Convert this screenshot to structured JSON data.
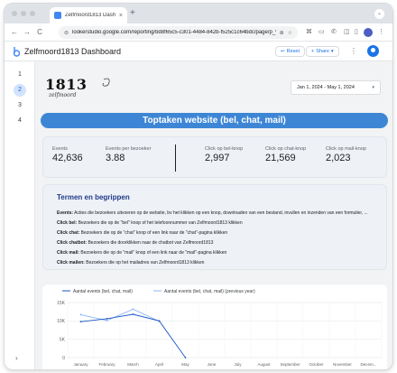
{
  "browser": {
    "tab_title": "Zelfmoord1813 Dashboard - ...",
    "tab_close": "×",
    "new_tab": "+",
    "tabs_menu": "⌄",
    "url": "lookerstudio.google.com/reporting/bd8f65c5-c301-4484-842b-f525c1c64bdc/page/p_%icjz...",
    "nav": {
      "back": "←",
      "forward": "→",
      "reload": "C"
    }
  },
  "app": {
    "title": "Zelfmoord1813 Dashboard",
    "reset_label": "Reset",
    "share_label": "Share",
    "reset_icon": "↩",
    "share_icon": "+",
    "share_caret": "▾",
    "more": "⋮"
  },
  "pages": [
    "1",
    "2",
    "3",
    "4"
  ],
  "active_page": "2",
  "collapse_icon": "›",
  "brand": {
    "number": "1813",
    "tagline": "zelfmoord"
  },
  "date_range": {
    "value": "Jan 1, 2024 - May 1, 2024",
    "caret": "▾"
  },
  "banner": "Toptaken website (bel, chat, mail)",
  "kpis": [
    {
      "label": "Events",
      "value": "42,636"
    },
    {
      "label": "Events per bezoeker",
      "value": "3.88"
    },
    {
      "label": "Click op bel-knop",
      "value": "2,997"
    },
    {
      "label": "Click op chat-knop",
      "value": "21,569"
    },
    {
      "label": "Click op mail-knop",
      "value": "2,023"
    }
  ],
  "terms": {
    "title": "Termen en begrippen",
    "items": [
      {
        "term": "Events:",
        "text": " Acties die bezoekers uitvoeren op de website, bv het klikken op een knop, downloaden van een bestand, invullen en inzenden van een formulier, ..."
      },
      {
        "term": "Click bel:",
        "text": " Bezoekers die op de \"bel\" knop of het telefoonnummer van Zelfmoord1813 klikken"
      },
      {
        "term": "Click chat:",
        "text": " Bezoekers die op de \"chat\" knop of een link naar de \"chat\"-pagina klikken"
      },
      {
        "term": "Click chatbot:",
        "text": " Bezoekers die doorklikken naar de chatbot van Zelfmoord1813"
      },
      {
        "term": "Click mail:",
        "text": " Bezoekers die op de \"mail\" knop of een link naar de \"mail\"-pagina klikken"
      },
      {
        "term": "Click mailen:",
        "text": " Bezoekers die op het mailadres van Zelfmoord1813 klikken"
      }
    ]
  },
  "chart_data": {
    "type": "line",
    "x": [
      "January",
      "February",
      "March",
      "April",
      "May",
      "June",
      "July",
      "August",
      "September",
      "October",
      "November",
      "Decem..."
    ],
    "series": [
      {
        "name": "Aantal events (bel, chat, mail)",
        "color": "#1a56c4",
        "values": [
          9800,
          10600,
          11800,
          10000,
          0,
          null,
          null,
          null,
          null,
          null,
          null,
          null
        ]
      },
      {
        "name": "Aantal events (bel, chat, mail) (previous year)",
        "color": "#8ab4f8",
        "values": [
          11700,
          10100,
          13200,
          9900,
          null,
          null,
          null,
          null,
          null,
          null,
          null,
          null
        ]
      }
    ],
    "y_ticks": [
      "15K",
      "10K",
      "5K",
      "0"
    ],
    "ylim": [
      0,
      15000
    ],
    "grid": true,
    "legend": "top-left"
  }
}
